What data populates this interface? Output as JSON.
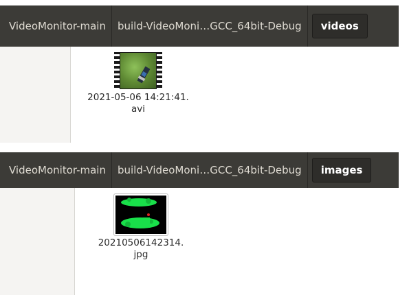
{
  "panels": [
    {
      "breadcrumbs": [
        "VideoMonitor-main",
        "build-VideoMoni…GCC_64bit-Debug",
        "videos"
      ],
      "file": {
        "name_line1": "2021-05-06 14:21:41.",
        "name_line2": "avi",
        "icon": "video-thumbnail-icon"
      }
    },
    {
      "breadcrumbs": [
        "VideoMonitor-main",
        "build-VideoMoni…GCC_64bit-Debug",
        "images"
      ],
      "file": {
        "name_line1": "20210506142314.",
        "name_line2": "jpg",
        "icon": "image-thumbnail-icon"
      }
    }
  ],
  "colors": {
    "pathbar_bg": "#3c3b37",
    "active_crumb_bg": "#2e2d2a",
    "thumb_green": "#19e04a"
  }
}
